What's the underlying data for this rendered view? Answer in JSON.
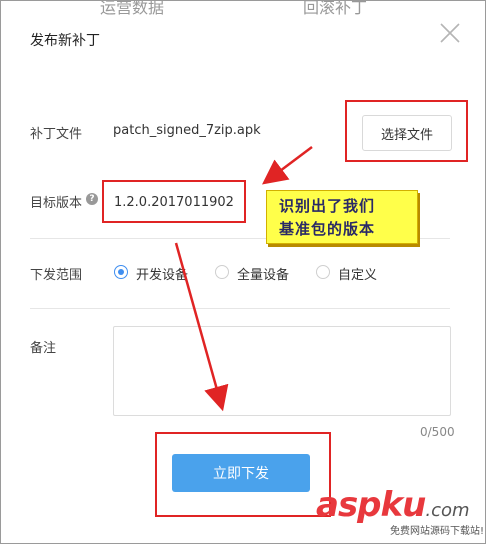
{
  "background_fragments": [
    "运营数据",
    "回滚补丁"
  ],
  "dialog": {
    "title": "发布新补丁",
    "patch_file_label": "补丁文件",
    "patch_file_name": "patch_signed_7zip.apk",
    "choose_file_button": "选择文件",
    "target_version_label": "目标版本",
    "target_version_value": "1.2.0.2017011902",
    "help_symbol": "?",
    "release_scope_label": "下发范围",
    "scope_options": [
      {
        "label": "开发设备",
        "selected": true
      },
      {
        "label": "全量设备",
        "selected": false
      },
      {
        "label": "自定义",
        "selected": false
      }
    ],
    "remarks_label": "备注",
    "remarks_value": "",
    "char_counter": "0/500",
    "publish_button": "立即下发"
  },
  "annotation": {
    "line1": "识别出了我们",
    "line2": "基准包的版本"
  },
  "watermark": {
    "brand": "aspku",
    "suffix": ".com",
    "tagline": "免费网站源码下载站!"
  },
  "colors": {
    "accent": "#4aa2ec",
    "annotation_red": "#e02424",
    "note_yellow": "#ffff4a"
  }
}
